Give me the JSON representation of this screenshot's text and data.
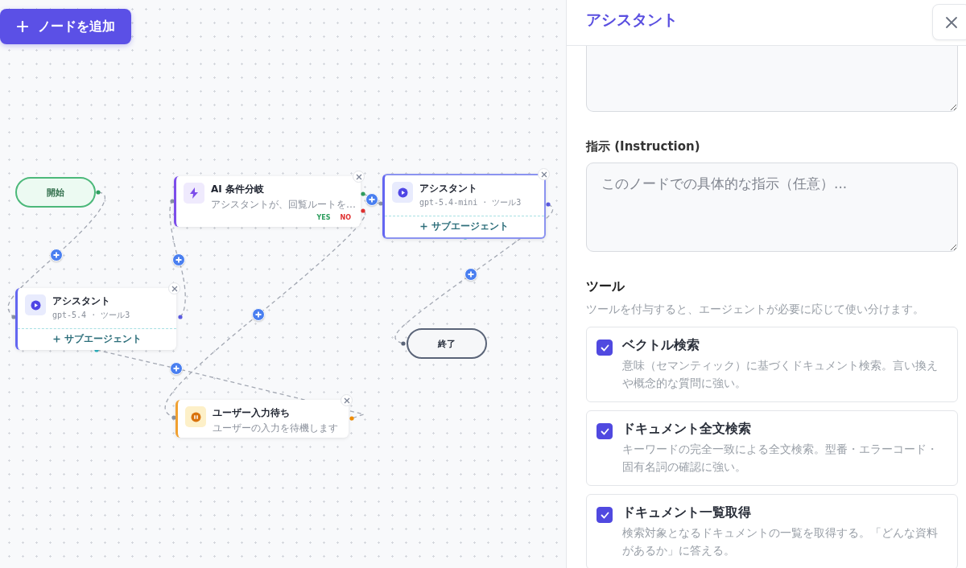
{
  "canvas": {
    "add_node_button": "ノードを追加",
    "nodes": [
      {
        "kind": "start",
        "label": "開始"
      },
      {
        "kind": "condition",
        "title": "AI 条件分岐",
        "subtitle": "アシスタントが、回覧ルートを…",
        "branches": [
          {
            "label": "YES",
            "color": "#2f9e5f"
          },
          {
            "label": "NO",
            "color": "#e03131"
          }
        ],
        "selected": false
      },
      {
        "kind": "agent",
        "title": "アシスタント",
        "subtitle": "gpt-5.4-mini · ツール3",
        "action": "サブエージェント",
        "selected": true
      },
      {
        "kind": "agent",
        "title": "アシスタント",
        "subtitle": "gpt-5.4 · ツール3",
        "action": "サブエージェント",
        "selected": false
      },
      {
        "kind": "end",
        "label": "終了"
      },
      {
        "kind": "wait",
        "title": "ユーザー入力待ち",
        "subtitle": "ユーザーの入力を待機します",
        "selected": false
      }
    ]
  },
  "panel": {
    "title": "アシスタント",
    "instruction": {
      "label": "指示 (Instruction)",
      "placeholder": "このノードでの具体的な指示（任意）..."
    },
    "tools": {
      "heading": "ツール",
      "description": "ツールを付与すると、エージェントが必要に応じて使い分けます。",
      "items": [
        {
          "name": "ベクトル検索",
          "description": "意味（セマンティック）に基づくドキュメント検索。言い換えや概念的な質問に強い。",
          "checked": true
        },
        {
          "name": "ドキュメント全文検索",
          "description": "キーワードの完全一致による全文検索。型番・エラーコード・固有名詞の確認に強い。",
          "checked": true
        },
        {
          "name": "ドキュメント一覧取得",
          "description": "検索対象となるドキュメントの一覧を取得する。「どんな資料があるか」に答える。",
          "checked": true
        }
      ]
    }
  }
}
